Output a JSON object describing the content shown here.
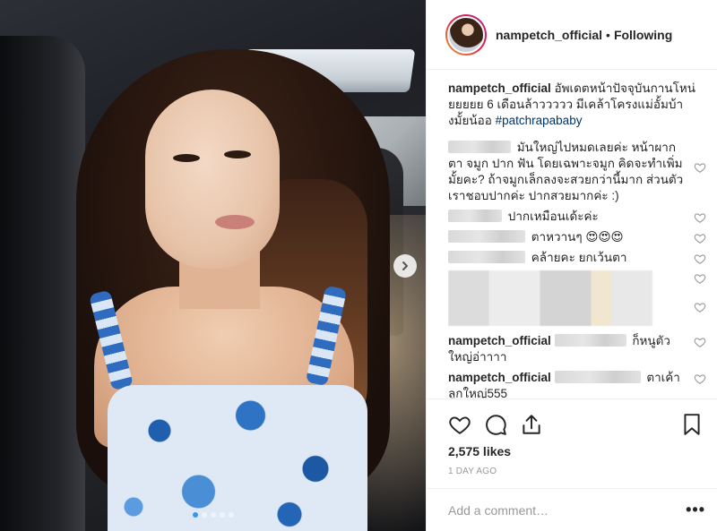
{
  "post": {
    "carousel_slide_count": 5,
    "carousel_active_index": 0
  },
  "header": {
    "username": "nampetch_official",
    "separator": "•",
    "follow_label": "Following"
  },
  "caption": {
    "username": "nampetch_official",
    "text": "อัพเดตหน้าปัจจุบันกานโหน่ยยยยย 6 เดือนล้าววววว มีเคล้าโครงแม่อั้มบ้างมั้ยน้ออ",
    "hashtag": "#patchrapababy"
  },
  "comments": [
    {
      "text": "มันใหญ่ไปหมดเลยค่ะ หน้าผาก ตา จมูก ปาก ฟัน โดยเฉพาะจมูก คิดจะทำเพิ่มมั้ยคะ? ถ้าจมูกเล็กลงจะสวยกว่านี้มาก ส่วนตัวเราชอบปากค่ะ ปากสวยมากค่ะ :)"
    },
    {
      "text": "ปากเหมือนเด้ะค่ะ"
    },
    {
      "text": "ตาหวานๆ 😍😍😍"
    },
    {
      "text": "คล้ายคะ ยกเว้นตา"
    }
  ],
  "replies": [
    {
      "username": "nampetch_official",
      "text": "ก็หนูตัวใหญ่อ่าาาา"
    },
    {
      "username": "nampetch_official",
      "text": "ตาเค้าลูกใหญ่555"
    }
  ],
  "actions": {
    "like_icon": "heart-icon",
    "comment_icon": "comment-bubble-icon",
    "share_icon": "share-icon",
    "save_icon": "bookmark-icon"
  },
  "likes_text": "2,575 likes",
  "age_text": "1 DAY AGO",
  "add_comment": {
    "placeholder": "Add a comment…",
    "more_label": "•••"
  }
}
